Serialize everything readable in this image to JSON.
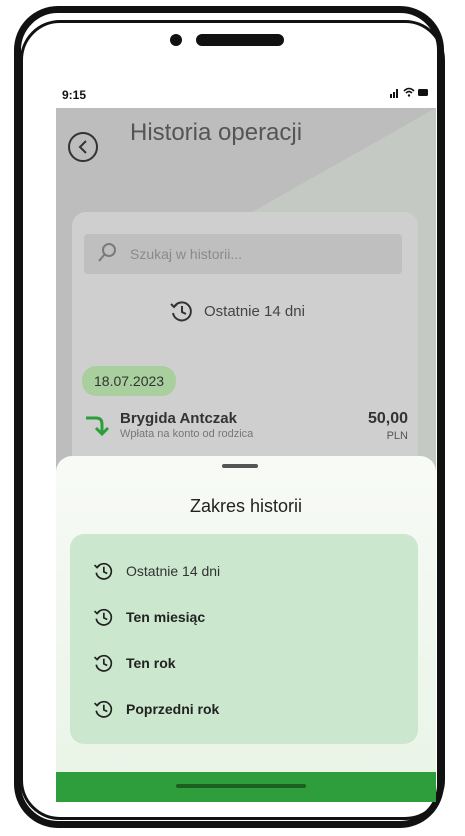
{
  "status": {
    "time": "9:15",
    "indicators": "signal wifi battery"
  },
  "header": {
    "title": "Historia operacji",
    "back_icon": "back-arrow-icon"
  },
  "search": {
    "placeholder": "Szukaj w historii..."
  },
  "filter": {
    "label": "Ostatnie 14 dni"
  },
  "date_group": "18.07.2023",
  "transaction": {
    "name": "Brygida Antczak",
    "description": "Wpłata na konto od rodzica",
    "amount": "50,00",
    "currency": "PLN"
  },
  "sheet": {
    "title": "Zakres historii",
    "options": [
      {
        "label": "Ostatnie 14 dni",
        "selected": true
      },
      {
        "label": "Ten miesiąc",
        "selected": false
      },
      {
        "label": "Ten rok",
        "selected": false
      },
      {
        "label": "Poprzedni rok",
        "selected": false
      }
    ]
  },
  "colors": {
    "accent": "#2e9e3c",
    "sheet_options_bg": "#cbe8cf",
    "date_pill": "#a8cf9d"
  }
}
